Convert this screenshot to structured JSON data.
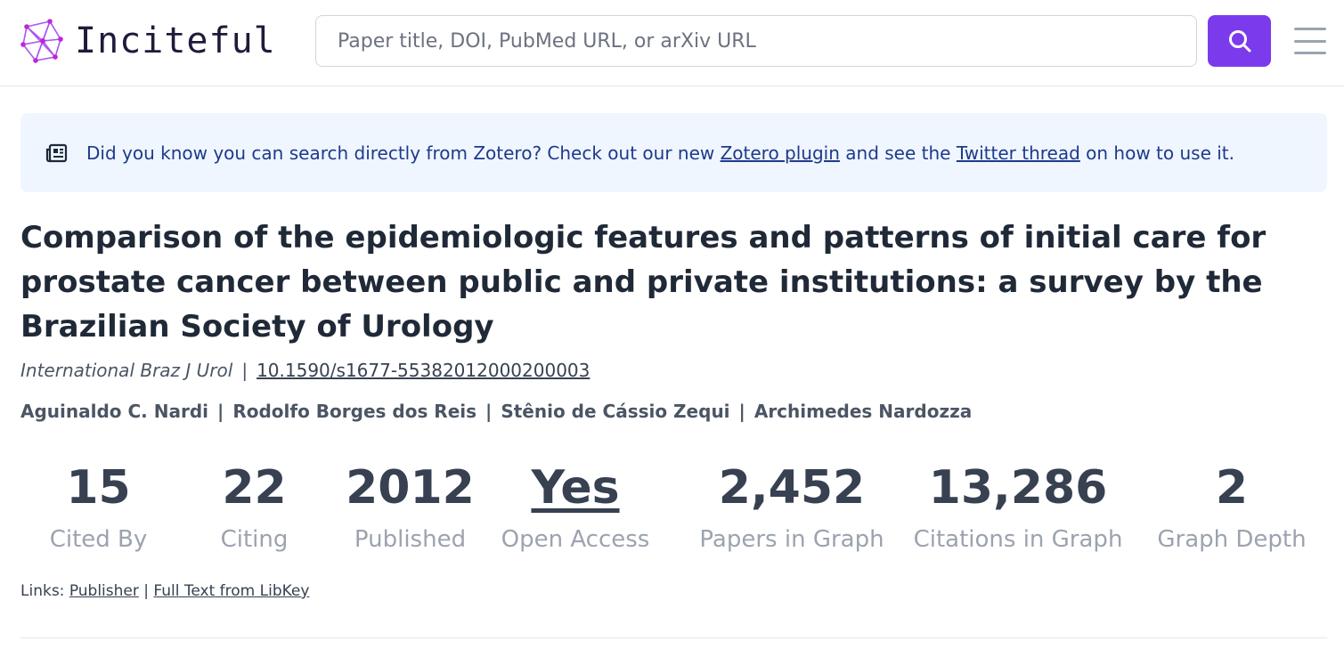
{
  "app": {
    "name": "Inciteful"
  },
  "search": {
    "placeholder": "Paper title, DOI, PubMed URL, or arXiv URL",
    "value": ""
  },
  "banner": {
    "text_before": "Did you know you can search directly from Zotero? Check out our new ",
    "zotero_link": "Zotero plugin",
    "text_middle": " and see the ",
    "twitter_link": "Twitter thread",
    "text_after": " on how to use it."
  },
  "paper": {
    "title": "Comparison of the epidemiologic features and patterns of initial care for prostate cancer between public and private institutions: a survey by the Brazilian Society of Urology",
    "journal": "International Braz J Urol",
    "separator": "|",
    "doi": "10.1590/s1677-55382012000200003",
    "authors": [
      "Aguinaldo C. Nardi",
      "Rodolfo Borges dos Reis",
      "Stênio de Cássio Zequi",
      "Archimedes Nardozza"
    ]
  },
  "stats": [
    {
      "value": "15",
      "label": "Cited By"
    },
    {
      "value": "22",
      "label": "Citing"
    },
    {
      "value": "2012",
      "label": "Published"
    },
    {
      "value": "Yes",
      "label": "Open Access"
    },
    {
      "value": "2,452",
      "label": "Papers in Graph"
    },
    {
      "value": "13,286",
      "label": "Citations in Graph"
    },
    {
      "value": "2",
      "label": "Graph Depth"
    }
  ],
  "links": {
    "prefix": "Links:",
    "publisher": "Publisher",
    "separator": "|",
    "libkey": "Full Text from LibKey"
  },
  "colors": {
    "accent": "#7c3aed",
    "banner_bg": "#eff6ff",
    "banner_text": "#1e3a8a"
  },
  "icons": {
    "logo": "network-logo-icon",
    "search": "search-icon",
    "menu": "hamburger-menu-icon",
    "banner": "newspaper-icon"
  }
}
